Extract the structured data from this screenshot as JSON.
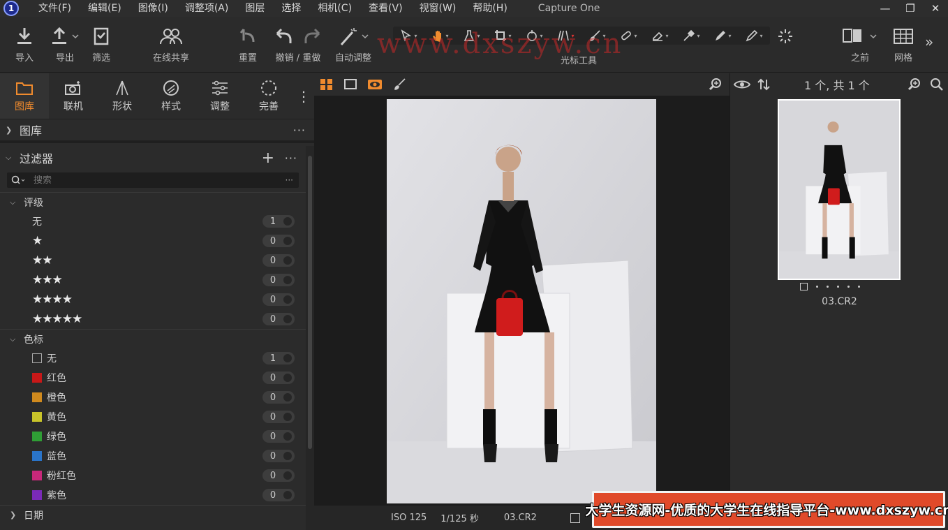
{
  "app": {
    "logo_text": "1",
    "title": "Capture One"
  },
  "menu": [
    "文件(F)",
    "编辑(E)",
    "图像(I)",
    "调整项(A)",
    "图层",
    "选择",
    "相机(C)",
    "查看(V)",
    "视窗(W)",
    "帮助(H)"
  ],
  "window": {
    "minimize": "—",
    "maximize": "❐",
    "close": "✕"
  },
  "toolbar": {
    "import": "导入",
    "export": "导出",
    "filter": "筛选",
    "share": "在线共享",
    "reset": "重置",
    "undo_redo": "撤销 / 重做",
    "auto_adjust": "自动调整",
    "cursor_tools": "光标工具",
    "before": "之前",
    "grid": "网格",
    "more": "»"
  },
  "watermark": "www.dxszyw.cn",
  "tool_tabs": [
    "图库",
    "联机",
    "形状",
    "样式",
    "调整",
    "完善"
  ],
  "tool_tabs_more": "⋮",
  "library": {
    "title": "图库",
    "more": "···"
  },
  "filters": {
    "title": "过滤器",
    "add": "+",
    "more": "···",
    "search_placeholder": "搜索",
    "search_more": "···",
    "rating_title": "评级",
    "ratings": [
      {
        "label": "无",
        "stars": "",
        "count": "1"
      },
      {
        "label": "",
        "stars": "★",
        "count": "0"
      },
      {
        "label": "",
        "stars": "★★",
        "count": "0"
      },
      {
        "label": "",
        "stars": "★★★",
        "count": "0"
      },
      {
        "label": "",
        "stars": "★★★★",
        "count": "0"
      },
      {
        "label": "",
        "stars": "★★★★★",
        "count": "0"
      }
    ],
    "color_title": "色标",
    "colors": [
      {
        "label": "无",
        "color": "none",
        "count": "1"
      },
      {
        "label": "红色",
        "color": "#c81818",
        "count": "0"
      },
      {
        "label": "橙色",
        "color": "#d08a1e",
        "count": "0"
      },
      {
        "label": "黄色",
        "color": "#c9c42a",
        "count": "0"
      },
      {
        "label": "绿色",
        "color": "#2f9e35",
        "count": "0"
      },
      {
        "label": "蓝色",
        "color": "#2a74c8",
        "count": "0"
      },
      {
        "label": "粉红色",
        "color": "#c8287a",
        "count": "0"
      },
      {
        "label": "紫色",
        "color": "#7a2ab8",
        "count": "0"
      }
    ],
    "date_title": "日期"
  },
  "viewer": {
    "iso": "ISO 125",
    "shutter": "1/125 秒",
    "filename": "03.CR2"
  },
  "browser": {
    "count": "1 个, 共 1 个",
    "thumb_name": "03.CR2"
  },
  "banner": "大学生资源网-优质的大学生在线指导平台-www.dxszyw.cn",
  "colors": {
    "accent": "#f08b2e",
    "panel": "#2b2b2b",
    "viewer_bg": "#1c1c1c"
  }
}
